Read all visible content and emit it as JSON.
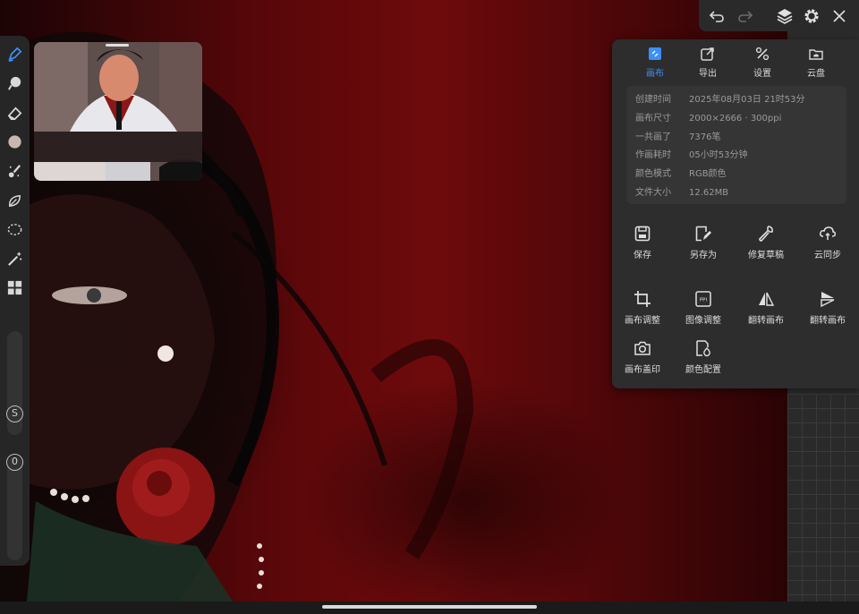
{
  "panel": {
    "tabs": [
      {
        "label": "画布",
        "icon": "canvas-icon",
        "active": true
      },
      {
        "label": "导出",
        "icon": "export-icon",
        "active": false
      },
      {
        "label": "设置",
        "icon": "settings-tools-icon",
        "active": false
      },
      {
        "label": "云盘",
        "icon": "cloud-folder-icon",
        "active": false
      }
    ],
    "info": [
      {
        "key": "创建时间",
        "value": "2025年08月03日 21时53分"
      },
      {
        "key": "画布尺寸",
        "value": "2000×2666 · 300ppi"
      },
      {
        "key": "一共画了",
        "value": "7376笔"
      },
      {
        "key": "作画耗时",
        "value": "05小时53分钟"
      },
      {
        "key": "颜色模式",
        "value": "RGB颜色"
      },
      {
        "key": "文件大小",
        "value": "12.62MB"
      }
    ],
    "actions": [
      {
        "label": "保存",
        "icon": "save-icon"
      },
      {
        "label": "另存为",
        "icon": "save-as-icon"
      },
      {
        "label": "修复草稿",
        "icon": "repair-icon"
      },
      {
        "label": "云同步",
        "icon": "cloud-sync-icon"
      },
      {
        "label": "画布调整",
        "icon": "crop-icon"
      },
      {
        "label": "图像调整",
        "icon": "ppi-icon"
      },
      {
        "label": "翻转画布",
        "icon": "flip-horizontal-icon"
      },
      {
        "label": "翻转画布",
        "icon": "flip-vertical-icon"
      },
      {
        "label": "画布盖印",
        "icon": "camera-icon"
      },
      {
        "label": "颜色配置",
        "icon": "color-profile-icon"
      }
    ]
  },
  "toolbar": {
    "slider_badges": [
      "S",
      "0"
    ]
  },
  "colors": {
    "accent": "#3d8ff5",
    "panel_bg": "#2d2d2d",
    "canvas_red": "#6e0a0c"
  }
}
